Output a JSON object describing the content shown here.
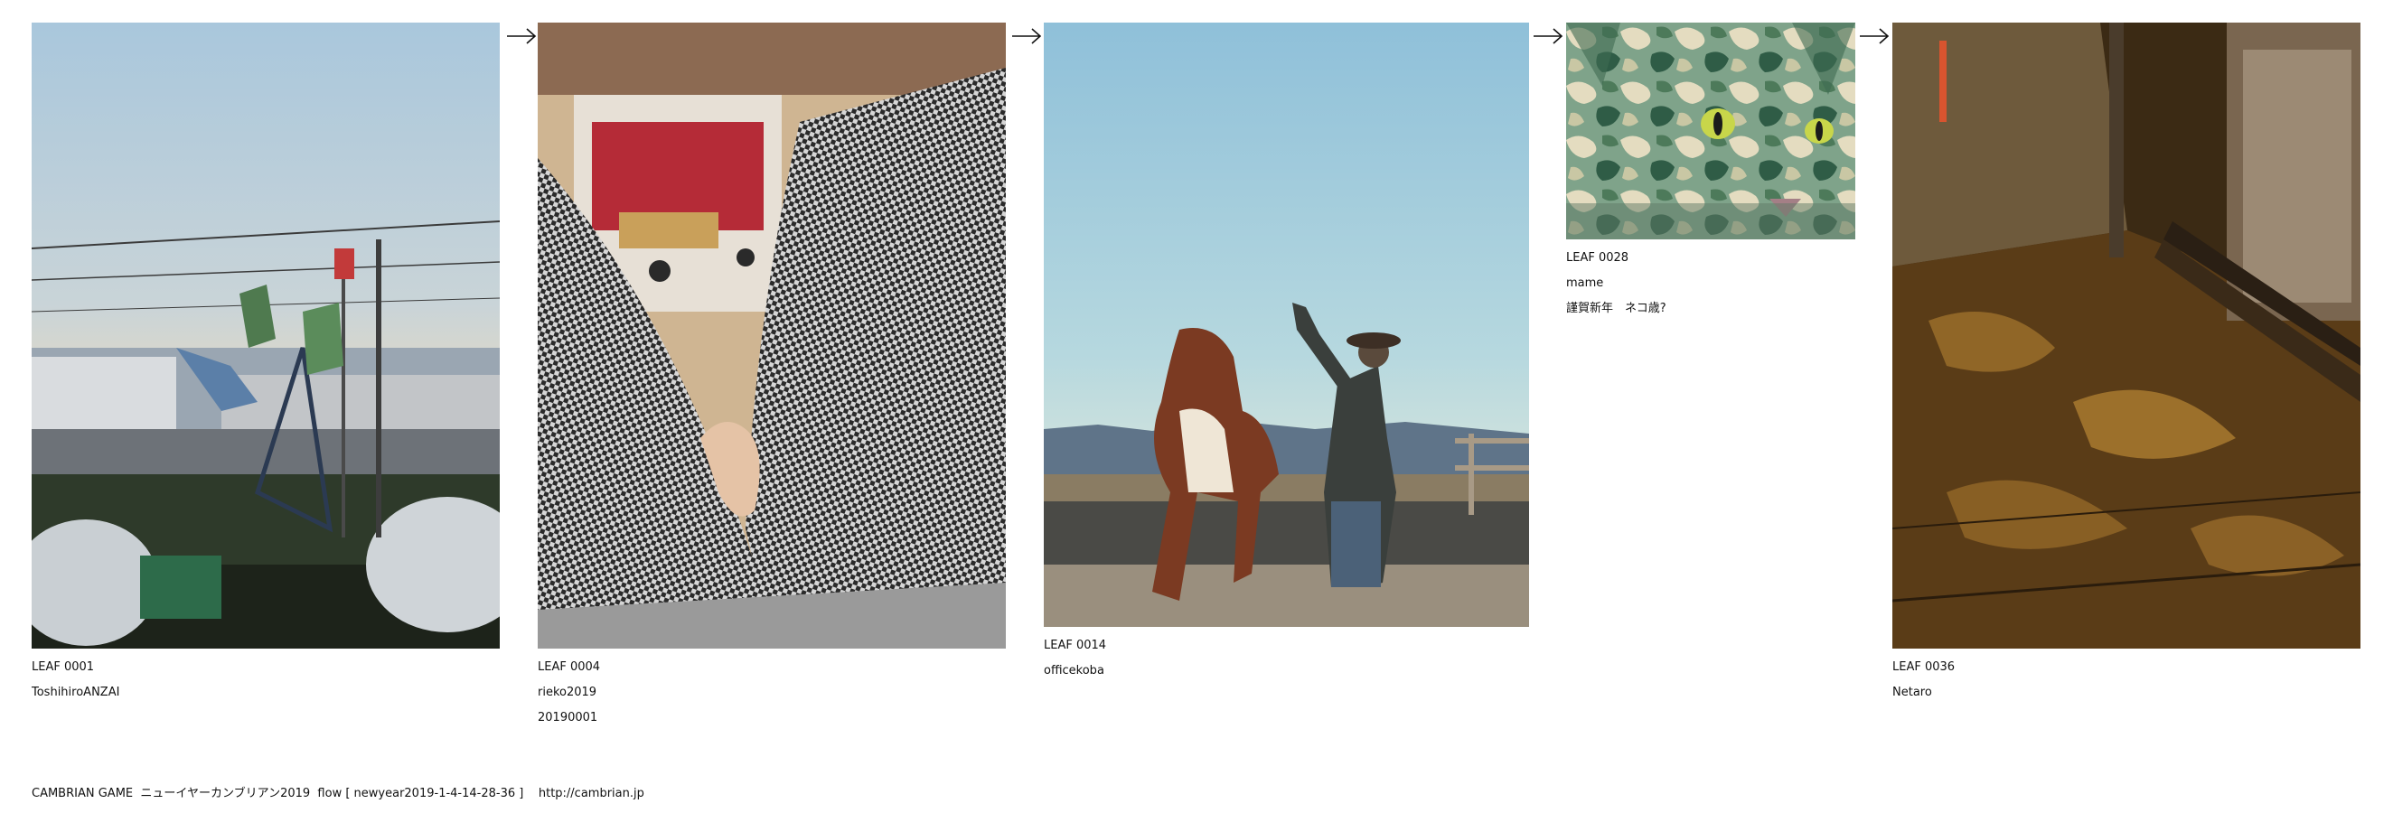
{
  "leaves": [
    {
      "id": "LEAF 0001",
      "lines": [
        "ToshihiroANZAI"
      ],
      "scene": "allotment garden at dusk with boots on poles, power lines and apartment blocks"
    },
    {
      "id": "LEAF 0004",
      "lines": [
        "rieko2019",
        "20190001"
      ],
      "scene": "lap view of houndstooth trousers and a bare foot on a wooden floor"
    },
    {
      "id": "LEAF 0014",
      "lines": [
        "officekoba"
      ],
      "scene": "a pony rearing up in front of a man in a cowboy hat"
    },
    {
      "id": "LEAF 0028",
      "lines": [
        "mame",
        "謹賀新年　ネコ歳?"
      ],
      "scene": "cat face with green camouflage pattern"
    },
    {
      "id": "LEAF 0036",
      "lines": [
        "Netaro"
      ],
      "scene": "night street with a bench and a wooden deck"
    }
  ],
  "arrow_icon": "right-arrow-icon",
  "footer": "CAMBRIAN GAME  ニューイヤーカンブリアン2019  flow [ newyear2019-1-4-14-28-36 ]    http://cambrian.jp"
}
